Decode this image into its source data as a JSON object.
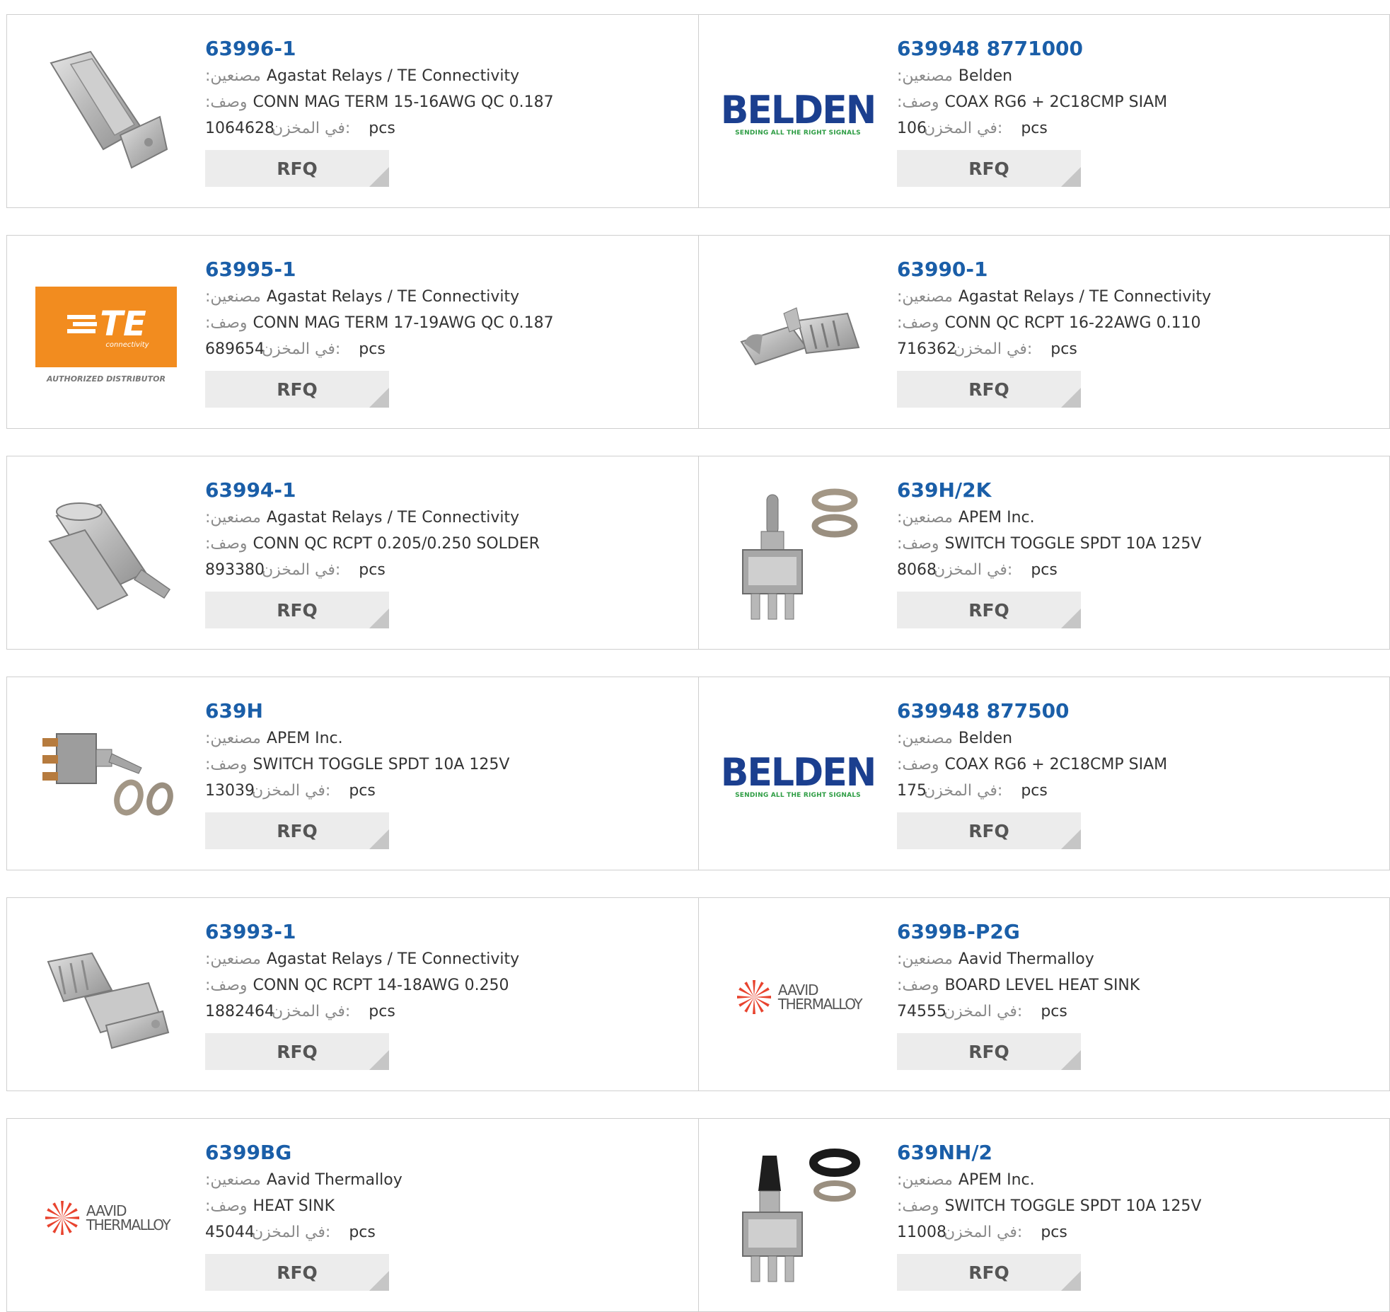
{
  "labels": {
    "manufacturer": ":مصنعين",
    "description": ":وصف",
    "stock": "في المخزن:",
    "unit": "pcs",
    "rfq": "RFQ"
  },
  "products": [
    {
      "part": "63996-1",
      "manufacturer": "Agastat Relays / TE Connectivity",
      "description": "CONN MAG TERM 15-16AWG QC 0.187",
      "stock": "1064628",
      "image": "qc-terminal-photo"
    },
    {
      "part": "639948 8771000",
      "manufacturer": "Belden",
      "description": "COAX RG6 + 2C18CMP SIAM",
      "stock": "106",
      "image": "belden-logo",
      "logo_text": "BELDEN",
      "logo_tagline": "SENDING ALL THE RIGHT SIGNALS"
    },
    {
      "part": "63995-1",
      "manufacturer": "Agastat Relays / TE Connectivity",
      "description": "CONN MAG TERM 17-19AWG QC 0.187",
      "stock": "689654",
      "image": "te-logo",
      "logo_text": "TE",
      "logo_sub": "connectivity",
      "logo_caption": "AUTHORIZED DISTRIBUTOR"
    },
    {
      "part": "63990-1",
      "manufacturer": "Agastat Relays / TE Connectivity",
      "description": "CONN QC RCPT 16-22AWG 0.110",
      "stock": "716362",
      "image": "qc-receptacle-photo"
    },
    {
      "part": "63994-1",
      "manufacturer": "Agastat Relays / TE Connectivity",
      "description": "CONN QC RCPT 0.205/0.250 SOLDER",
      "stock": "893380",
      "image": "solder-receptacle-photo"
    },
    {
      "part": "639H/2K",
      "manufacturer": "APEM Inc.",
      "description": "SWITCH TOGGLE SPDT 10A 125V",
      "stock": "8068",
      "image": "toggle-switch-photo"
    },
    {
      "part": "639H",
      "manufacturer": "APEM Inc.",
      "description": "SWITCH TOGGLE SPDT 10A 125V",
      "stock": "13039",
      "image": "toggle-switch-side-photo"
    },
    {
      "part": "639948 877500",
      "manufacturer": "Belden",
      "description": "COAX RG6 + 2C18CMP SIAM",
      "stock": "175",
      "image": "belden-logo",
      "logo_text": "BELDEN",
      "logo_tagline": "SENDING ALL THE RIGHT SIGNALS"
    },
    {
      "part": "63993-1",
      "manufacturer": "Agastat Relays / TE Connectivity",
      "description": "CONN QC RCPT 14-18AWG 0.250",
      "stock": "1882464",
      "image": "crimp-receptacle-photo"
    },
    {
      "part": "6399B-P2G",
      "manufacturer": "Aavid Thermalloy",
      "description": "BOARD LEVEL HEAT SINK",
      "stock": "74555",
      "image": "aavid-logo",
      "logo_line1": "AAVID",
      "logo_line2": "THERMALLOY"
    },
    {
      "part": "6399BG",
      "manufacturer": "Aavid Thermalloy",
      "description": "HEAT SINK",
      "stock": "45044",
      "image": "aavid-logo",
      "logo_line1": "AAVID",
      "logo_line2": "THERMALLOY"
    },
    {
      "part": "639NH/2",
      "manufacturer": "APEM Inc.",
      "description": "SWITCH TOGGLE SPDT 10A 125V",
      "stock": "11008",
      "image": "toggle-switch-black-photo"
    }
  ],
  "colors": {
    "part_link": "#1a5ea8",
    "belden_blue": "#1b3f8f",
    "belden_green": "#2e9d44",
    "te_orange": "#f28c1f",
    "aavid_red": "#e8432e"
  }
}
